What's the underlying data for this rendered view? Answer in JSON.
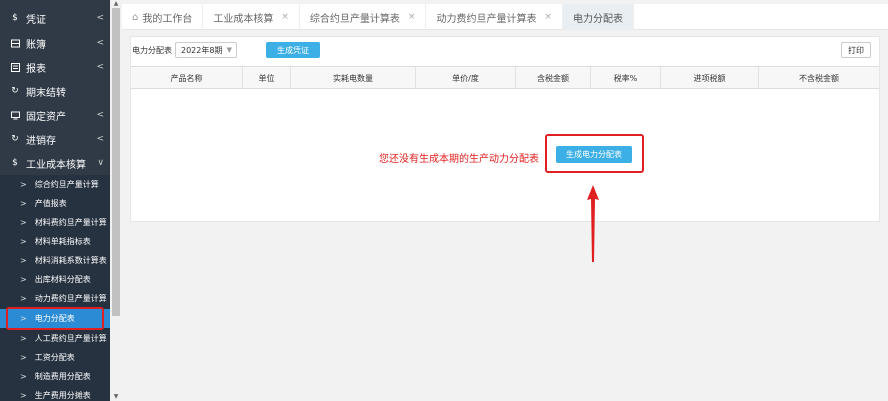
{
  "sidebar": {
    "menu": [
      {
        "label": "凭证",
        "icon": "dollar-icon"
      },
      {
        "label": "账簿",
        "icon": "book-icon"
      },
      {
        "label": "报表",
        "icon": "report-icon"
      },
      {
        "label": "期末结转",
        "icon": "cycle-icon"
      },
      {
        "label": "固定资产",
        "icon": "monitor-icon"
      },
      {
        "label": "进销存",
        "icon": "cycle-icon"
      },
      {
        "label": "工业成本核算",
        "icon": "dollar-icon"
      }
    ],
    "submenu": [
      {
        "label": "综合约旦产量计算"
      },
      {
        "label": "产值报表"
      },
      {
        "label": "材料费约旦产量计算"
      },
      {
        "label": "材料单耗指标表"
      },
      {
        "label": "材料消耗系数计算表"
      },
      {
        "label": "出库材料分配表"
      },
      {
        "label": "动力费约旦产量计算"
      },
      {
        "label": "电力分配表"
      },
      {
        "label": "人工费约旦产量计算"
      },
      {
        "label": "工资分配表"
      },
      {
        "label": "制造费用分配表"
      },
      {
        "label": "生产费用分摊表"
      }
    ],
    "active_submenu_index": 7
  },
  "tabs": [
    {
      "label": "我的工作台",
      "closable": false,
      "home": true
    },
    {
      "label": "工业成本核算",
      "closable": true
    },
    {
      "label": "综合约旦产量计算表",
      "closable": true
    },
    {
      "label": "动力费约旦产量计算表",
      "closable": true
    },
    {
      "label": "电力分配表",
      "closable": false,
      "active": true
    }
  ],
  "toolbar": {
    "label": "电力分配表",
    "period_value": "2022年8期",
    "generate_voucher_label": "生成凭证",
    "print_label": "打印"
  },
  "table": {
    "columns": [
      "产品名称",
      "单位",
      "实耗电数量",
      "单价/度",
      "含税金额",
      "税率%",
      "进项税额",
      "不含税金额"
    ]
  },
  "empty_state": {
    "message": "您还没有生成本期的生产动力分配表",
    "button_label": "生成电力分配表"
  },
  "colors": {
    "sidebar_bg": "#2f3a46",
    "accent": "#3cb0e6",
    "highlight": "#e02020"
  }
}
